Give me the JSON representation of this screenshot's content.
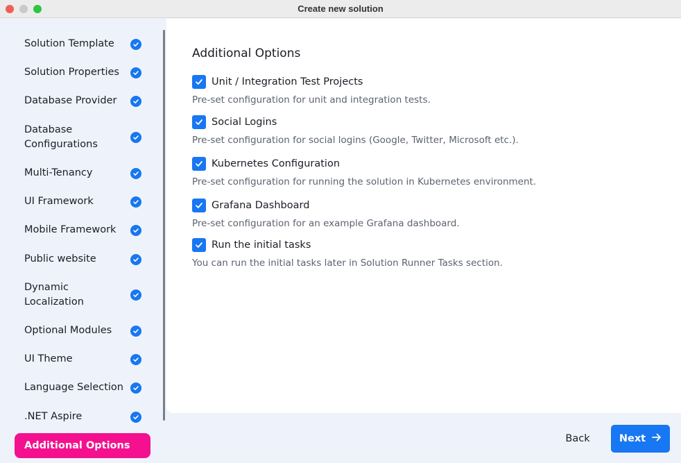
{
  "window": {
    "title": "Create new solution"
  },
  "sidebar": {
    "steps": [
      {
        "label": "Solution Template",
        "completed": true
      },
      {
        "label": "Solution Properties",
        "completed": true
      },
      {
        "label": "Database Provider",
        "completed": true
      },
      {
        "label": "Database Configurations",
        "completed": true
      },
      {
        "label": "Multi-Tenancy",
        "completed": true
      },
      {
        "label": "UI Framework",
        "completed": true
      },
      {
        "label": "Mobile Framework",
        "completed": true
      },
      {
        "label": "Public website",
        "completed": true
      },
      {
        "label": "Dynamic Localization",
        "completed": true
      },
      {
        "label": "Optional Modules",
        "completed": true
      },
      {
        "label": "UI Theme",
        "completed": true
      },
      {
        "label": "Language Selection",
        "completed": true
      },
      {
        "label": ".NET Aspire",
        "completed": true
      },
      {
        "label": "Additional Options",
        "active": true
      }
    ],
    "step_icon": "check-circle-icon"
  },
  "main": {
    "title": "Additional Options",
    "options": [
      {
        "label": "Unit / Integration Test Projects",
        "description": "Pre-set configuration for unit and integration tests.",
        "checked": true
      },
      {
        "label": "Social Logins",
        "description": "Pre-set configuration for social logins (Google, Twitter, Microsoft etc.).",
        "checked": true
      },
      {
        "label": "Kubernetes Configuration",
        "description": "Pre-set configuration for running the solution in Kubernetes environment.",
        "checked": true
      },
      {
        "label": "Grafana Dashboard",
        "description": "Pre-set configuration for an example Grafana dashboard.",
        "checked": true
      },
      {
        "label": "Run the initial tasks",
        "description": "You can run the initial tasks later in Solution Runner Tasks section.",
        "checked": true
      }
    ]
  },
  "footer": {
    "back_label": "Back",
    "next_label": "Next",
    "next_icon": "arrow-right-icon"
  },
  "colors": {
    "accent": "#1877f2",
    "active_step": "#f4108f",
    "sidebar_bg": "#eef3fb"
  }
}
